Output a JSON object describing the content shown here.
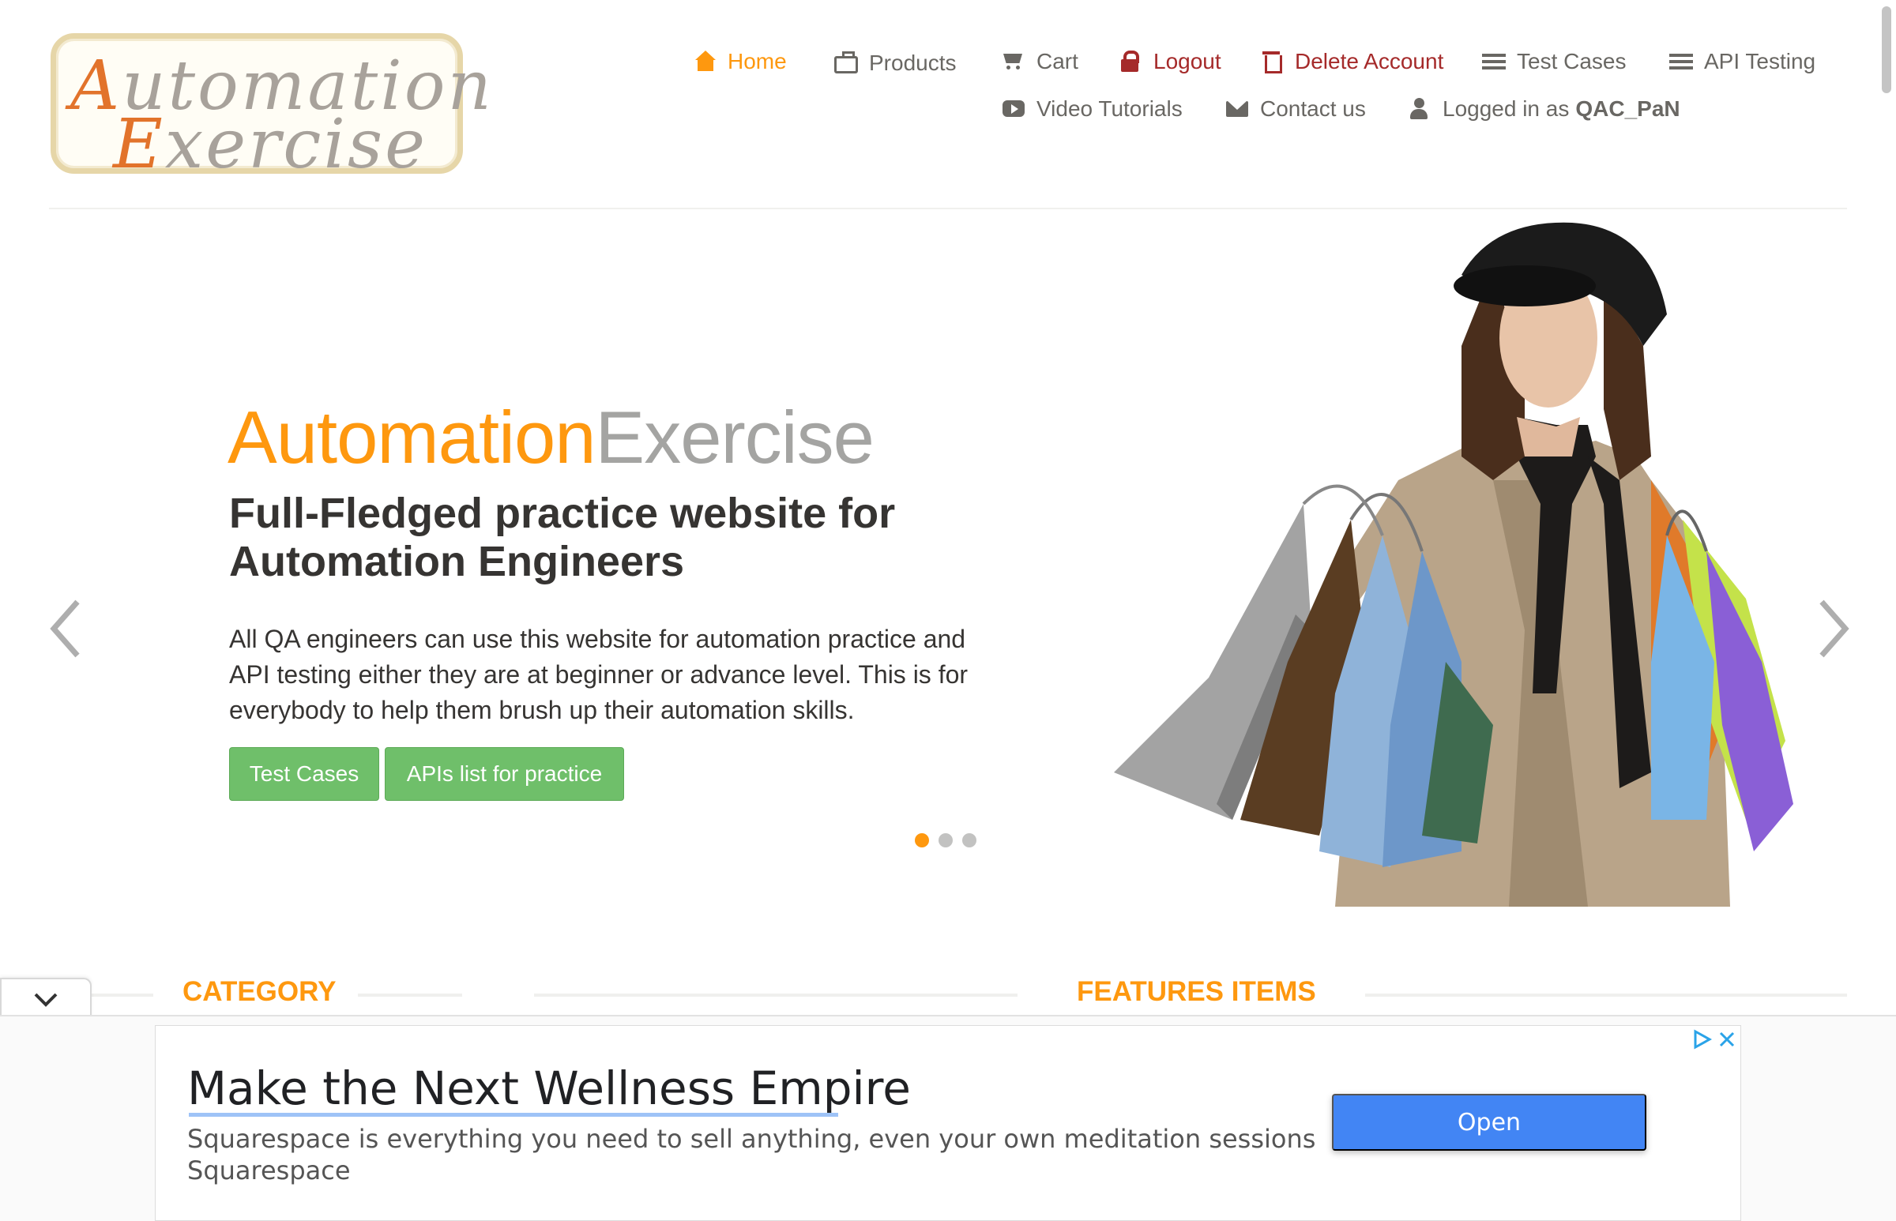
{
  "logo": {
    "line1_first": "A",
    "line1_rest": "utomation",
    "line2_first": "E",
    "line2_rest": "xercise"
  },
  "nav": {
    "home": "Home",
    "products": "Products",
    "cart": "Cart",
    "logout": "Logout",
    "delete_account": "Delete Account",
    "test_cases": "Test Cases",
    "api_testing": "API Testing",
    "video_tutorials": "Video Tutorials",
    "contact_us": "Contact us",
    "logged_in_prefix": "Logged in as",
    "username": "QAC_PaN"
  },
  "hero": {
    "brand_part1": "Automation",
    "brand_part2": "Exercise",
    "title": "Full-Fledged practice website for Automation Engineers",
    "text": "All QA engineers can use this website for automation practice and API testing either they are at beginner or advance level. This is for everybody to help them brush up their automation skills.",
    "btn_test_cases": "Test Cases",
    "btn_apis": "APIs list for practice",
    "active_slide": 1,
    "slide_count": 3
  },
  "sections": {
    "category": "CATEGORY",
    "features": "FEATURES ITEMS"
  },
  "ad": {
    "headline": "Make the Next Wellness Empire",
    "description": "Squarespace is everything you need to sell anything, even your own meditation sessions",
    "source": "Squarespace",
    "open_label": "Open"
  },
  "colors": {
    "accent": "#fe980f",
    "danger": "#a52a2a",
    "button_green": "#6fbf6a",
    "ad_button": "#4285f4"
  },
  "icons": [
    "home-icon",
    "briefcase-icon",
    "cart-icon",
    "lock-icon",
    "trash-icon",
    "list-icon",
    "video-icon",
    "envelope-icon",
    "user-icon",
    "chevron-left-icon",
    "chevron-right-icon",
    "chevron-down-icon",
    "adchoices-icon",
    "close-icon"
  ]
}
